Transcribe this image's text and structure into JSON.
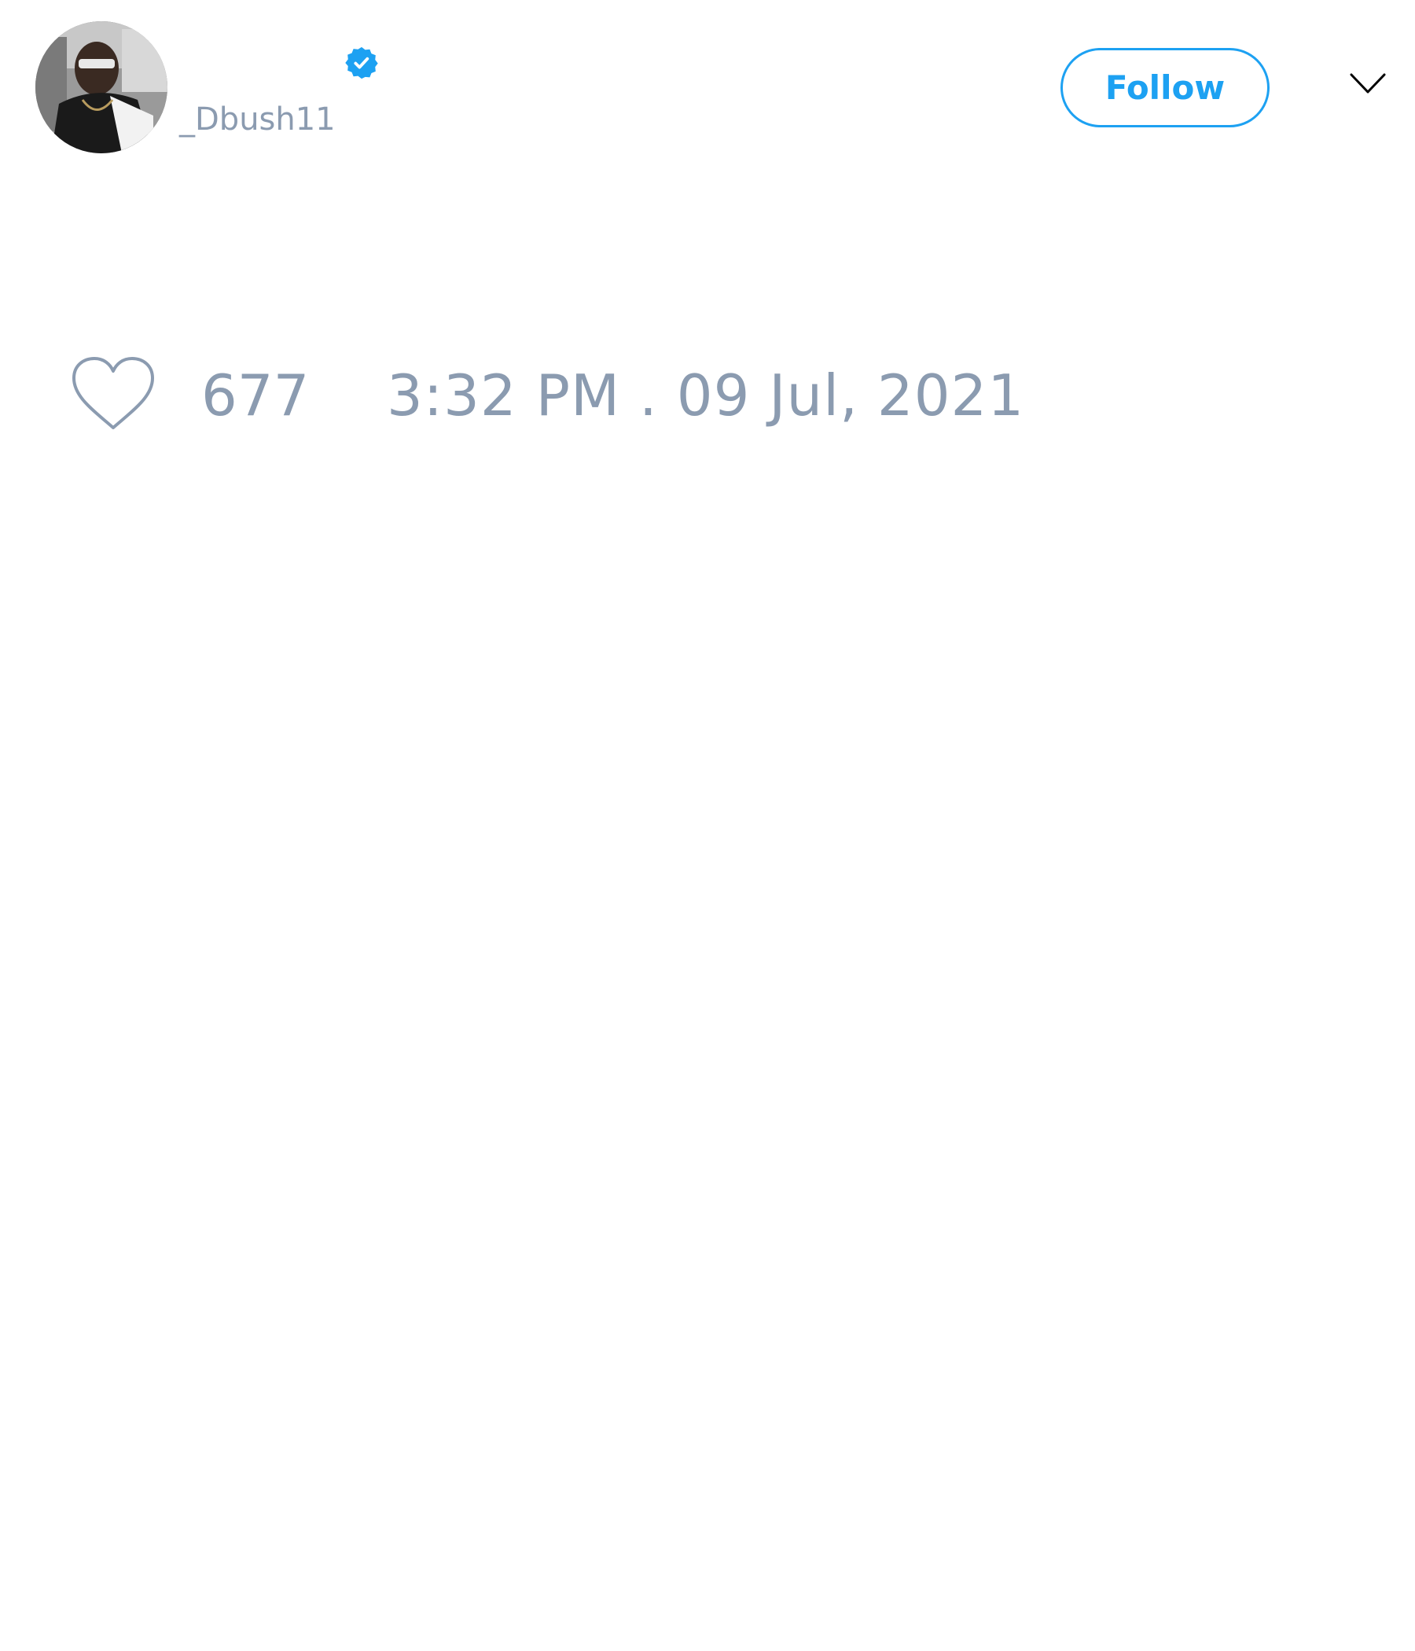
{
  "tweet": {
    "author": {
      "handle": "_Dbush11",
      "verified": true,
      "avatar_icon": "profile-photo"
    },
    "follow_button": {
      "label": "Follow"
    },
    "menu_icon": "chevron-down-icon",
    "likes": {
      "icon": "heart-outline-icon",
      "count": "677"
    },
    "timestamp": "3:32 PM . 09 Jul, 2021"
  },
  "colors": {
    "accent": "#1da1f2",
    "muted_text": "#8b9bb0",
    "background": "#ffffff"
  }
}
